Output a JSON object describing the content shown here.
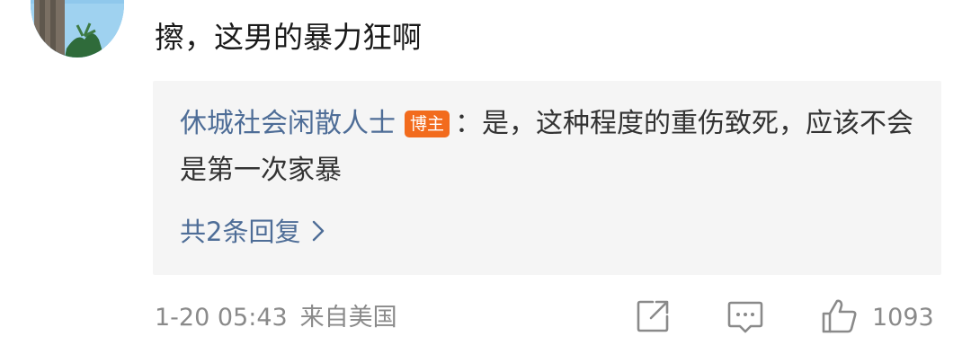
{
  "comment": {
    "text": "擦，这男的暴力狂啊"
  },
  "reply": {
    "author": "休城社会闲散人士",
    "badge": "博主",
    "separator": "：",
    "text": "是，这种程度的重伤致死，应该不会是第一次家暴",
    "more_label": "共2条回复"
  },
  "meta": {
    "date": "1-20 05:43",
    "location": "来自美国"
  },
  "actions": {
    "share_icon": "share-icon",
    "comment_icon": "comment-icon",
    "like_icon": "thumbs-up-icon",
    "like_count": "1093"
  },
  "colors": {
    "link": "#4e6d97",
    "badge": "#f26b1d",
    "reply_bg": "#f5f5f5",
    "meta": "#8a8a8a"
  }
}
